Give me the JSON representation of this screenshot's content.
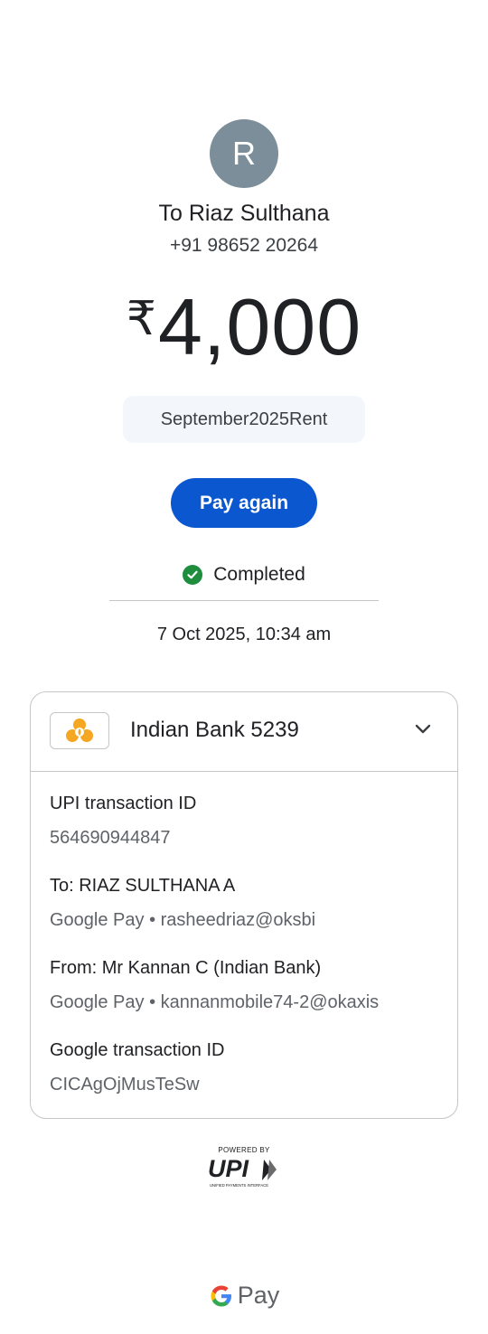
{
  "recipient": {
    "initial": "R",
    "name_line": "To Riaz Sulthana",
    "phone": "+91 98652 20264"
  },
  "amount": {
    "currency": "₹",
    "value": "4,000"
  },
  "note": "September2025Rent",
  "pay_again_label": "Pay again",
  "status": {
    "text": "Completed",
    "icon": "check-circle-icon",
    "color": "#1e8e3e"
  },
  "datetime": "7 Oct 2025, 10:34 am",
  "details": {
    "bank_name": "Indian Bank 5239",
    "upi_transaction_id_label": "UPI transaction ID",
    "upi_transaction_id": "564690944847",
    "to_label": "To: RIAZ SULTHANA  A",
    "to_value": "Google Pay • rasheedriaz@oksbi",
    "from_label": "From: Mr Kannan C (Indian Bank)",
    "from_value": "Google Pay • kannanmobile74-2@okaxis",
    "google_txn_label": "Google transaction ID",
    "google_txn_id": "CICAgOjMusTeSw"
  },
  "footer": {
    "upi_powered_by": "POWERED BY",
    "upi_text": "UPI",
    "upi_subtitle": "UNIFIED PAYMENTS INTERFACE",
    "gpay_text": "Pay"
  },
  "colors": {
    "accent": "#0b57d0",
    "avatar": "#7b8e99"
  }
}
